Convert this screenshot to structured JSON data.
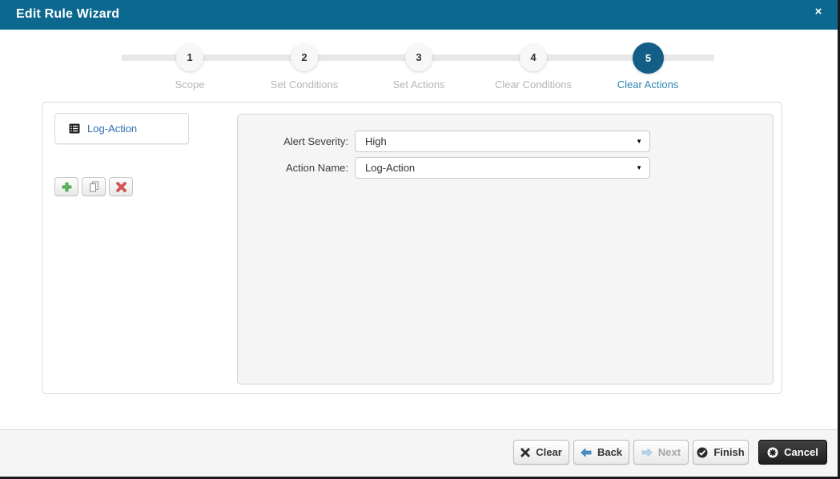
{
  "window": {
    "title": "Edit Rule Wizard",
    "close_glyph": "×"
  },
  "steps": [
    {
      "number": "1",
      "label": "Scope",
      "active": false
    },
    {
      "number": "2",
      "label": "Set Conditions",
      "active": false
    },
    {
      "number": "3",
      "label": "Set Actions",
      "active": false
    },
    {
      "number": "4",
      "label": "Clear Conditions",
      "active": false
    },
    {
      "number": "5",
      "label": "Clear Actions",
      "active": true
    }
  ],
  "action_list": {
    "items": [
      {
        "label": "Log-Action",
        "icon": "list-icon",
        "selected": true
      }
    ],
    "toolbar": [
      {
        "icon": "add-plus-icon"
      },
      {
        "icon": "copy-icon"
      },
      {
        "icon": "delete-x-icon"
      }
    ]
  },
  "form": {
    "dropdown_arrow": "▼",
    "fields": [
      {
        "label": "Alert Severity:",
        "value": "High"
      },
      {
        "label": "Action Name:",
        "value": "Log-Action"
      }
    ]
  },
  "footer": {
    "buttons": [
      {
        "label": "Clear",
        "icon": "clear-x-icon",
        "disabled": false,
        "dark": false
      },
      {
        "label": "Back",
        "icon": "back-arrow-icon",
        "disabled": false,
        "dark": false
      },
      {
        "label": "Next",
        "icon": "next-arrow-icon",
        "disabled": true,
        "dark": false
      },
      {
        "label": "Finish",
        "icon": "finish-check-icon",
        "disabled": false,
        "dark": false
      },
      {
        "label": "Cancel",
        "icon": "cancel-circle-icon",
        "disabled": false,
        "dark": true
      }
    ]
  },
  "colors": {
    "header_bg": "#0d6890",
    "active_step_bg": "#135e87",
    "active_step_label": "#2c84b0",
    "inactive_step_label": "#b5b5b5",
    "action_link_blue": "#2d6fb0",
    "add_green": "#5cb85c",
    "delete_red": "#d9534f",
    "footer_bg": "#f5f5f5",
    "dark_button_bg": "#1f1f1f"
  }
}
